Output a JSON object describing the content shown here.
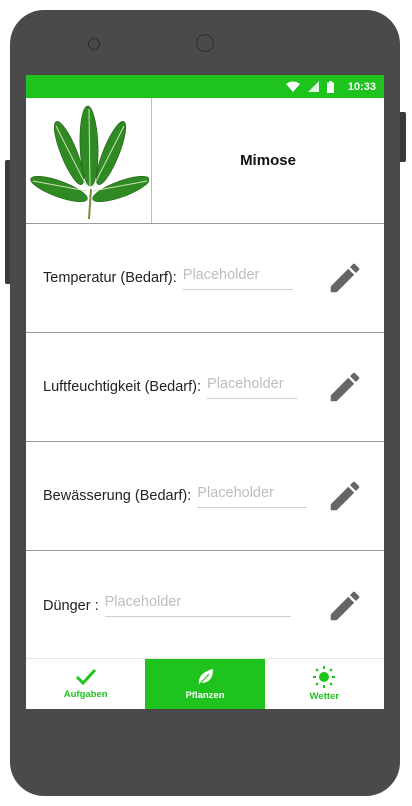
{
  "status_bar": {
    "time": "10:33"
  },
  "plant": {
    "name": "Mimose",
    "image_icon": "mimosa-leaf-image"
  },
  "rows": [
    {
      "label": "Temperatur (Bedarf):",
      "placeholder": "Placeholder",
      "icon": "pencil-icon"
    },
    {
      "label": "Luftfeuchtigkeit (Bedarf):",
      "placeholder": "Placeholder",
      "icon": "pencil-icon"
    },
    {
      "label": "Bewässerung (Bedarf):",
      "placeholder": "Placeholder",
      "icon": "pencil-icon"
    },
    {
      "label": "Dünger :",
      "placeholder": "Placeholder",
      "icon": "pencil-icon"
    }
  ],
  "tabs": [
    {
      "label": "Aufgaben",
      "icon": "check-icon",
      "active": false
    },
    {
      "label": "Pflanzen",
      "icon": "leaf-icon",
      "active": true
    },
    {
      "label": "Wetter",
      "icon": "sun-icon",
      "active": false
    }
  ],
  "colors": {
    "accent": "#1ec31e",
    "frame": "#4a4a4a",
    "icon_gray": "#666666"
  }
}
